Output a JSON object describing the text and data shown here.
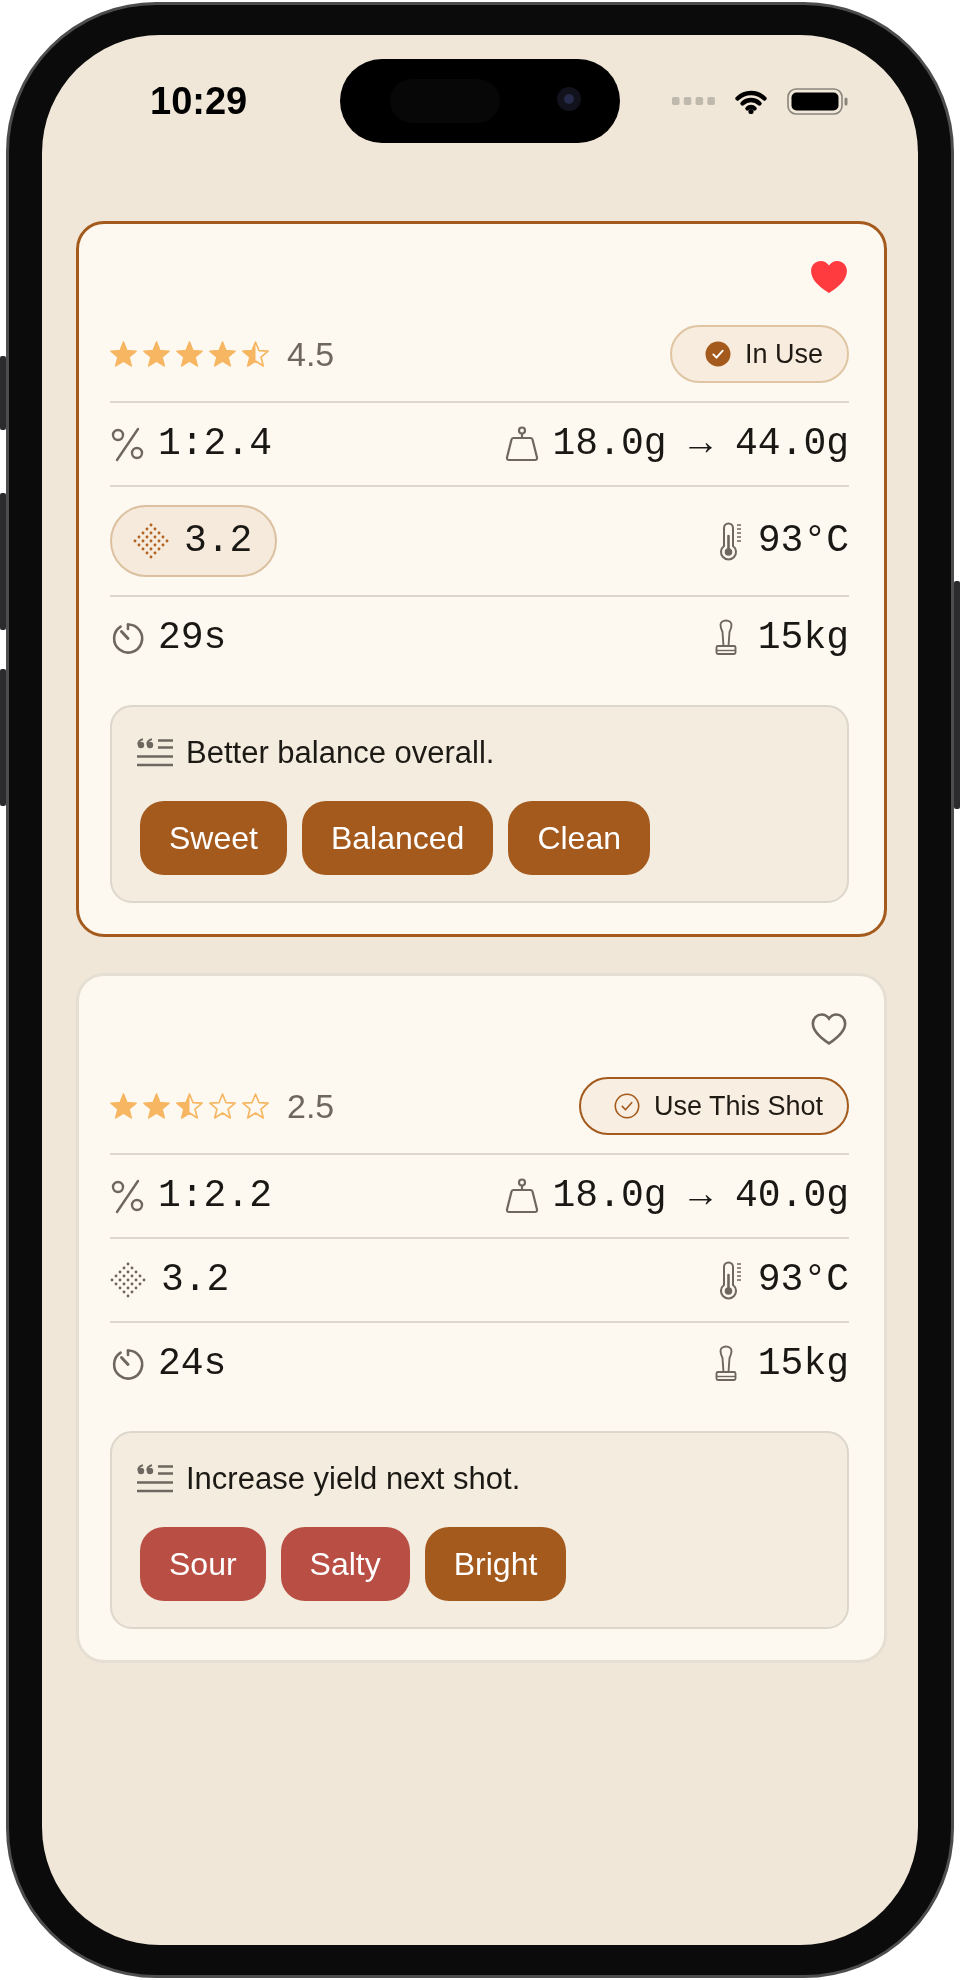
{
  "status_bar": {
    "time": "10:29"
  },
  "shots": [
    {
      "selected": true,
      "favorite": true,
      "stars": 4.5,
      "rating": "4.5",
      "button": "In Use",
      "ratio": "1:2.4",
      "dose_yield": "18.0g → 44.0g",
      "grind": {
        "value": "3.2",
        "highlighted": true
      },
      "temperature": "93°C",
      "time": "29s",
      "pressure": "15kg",
      "note": "Better balance overall.",
      "tags": [
        {
          "label": "Sweet",
          "color": "#a4591d"
        },
        {
          "label": "Balanced",
          "color": "#a4591d"
        },
        {
          "label": "Clean",
          "color": "#a4591d"
        }
      ]
    },
    {
      "selected": false,
      "favorite": false,
      "stars": 2.5,
      "rating": "2.5",
      "button": "Use This Shot",
      "ratio": "1:2.2",
      "dose_yield": "18.0g → 40.0g",
      "grind": {
        "value": "3.2",
        "highlighted": false
      },
      "temperature": "93°C",
      "time": "24s",
      "pressure": "15kg",
      "note": "Increase yield next shot.",
      "tags": [
        {
          "label": "Sour",
          "color": "#b84e44"
        },
        {
          "label": "Salty",
          "color": "#b84e44"
        },
        {
          "label": "Bright",
          "color": "#a4591d"
        }
      ]
    }
  ]
}
